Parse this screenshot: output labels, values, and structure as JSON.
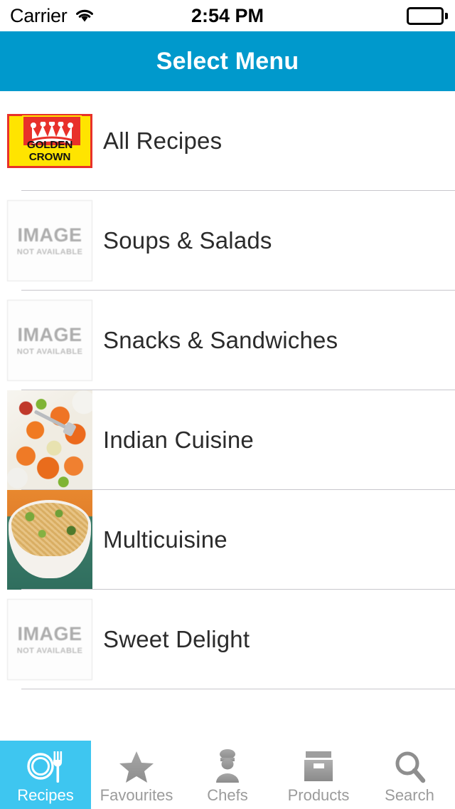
{
  "status_bar": {
    "carrier": "Carrier",
    "wifi_icon": "wifi-icon",
    "time": "2:54 PM",
    "battery_icon": "battery-full-icon"
  },
  "header": {
    "title": "Select Menu",
    "background_color": "#0099cc",
    "title_color": "#ffffff"
  },
  "list": {
    "rows": [
      {
        "label": "All Recipes",
        "thumb_type": "logo",
        "logo": {
          "brand": "GOLDEN CROWN",
          "border_color": "#e8312a",
          "panel_color": "#ffe400",
          "crown_color": "#ffffff"
        }
      },
      {
        "label": "Soups & Salads",
        "thumb_type": "placeholder",
        "placeholder": {
          "primary": "IMAGE",
          "secondary": "NOT AVAILABLE"
        }
      },
      {
        "label": "Snacks & Sandwiches",
        "thumb_type": "placeholder",
        "placeholder": {
          "primary": "IMAGE",
          "secondary": "NOT AVAILABLE"
        }
      },
      {
        "label": "Indian Cuisine",
        "thumb_type": "photo",
        "photo_alt": "indian-curry-dish-photo"
      },
      {
        "label": "Multicuisine",
        "thumb_type": "photo",
        "photo_alt": "fried-rice-bowl-photo"
      },
      {
        "label": "Sweet Delight",
        "thumb_type": "placeholder",
        "placeholder": {
          "primary": "IMAGE",
          "secondary": "NOT AVAILABLE"
        }
      }
    ]
  },
  "tab_bar": {
    "active_color": "#3ec6f0",
    "inactive_color": "#9b9b9b",
    "tabs": [
      {
        "label": "Recipes",
        "icon": "plate-fork-icon",
        "active": true
      },
      {
        "label": "Favourites",
        "icon": "star-icon",
        "active": false
      },
      {
        "label": "Chefs",
        "icon": "chef-icon",
        "active": false
      },
      {
        "label": "Products",
        "icon": "box-icon",
        "active": false
      },
      {
        "label": "Search",
        "icon": "magnifier-icon",
        "active": false
      }
    ]
  }
}
